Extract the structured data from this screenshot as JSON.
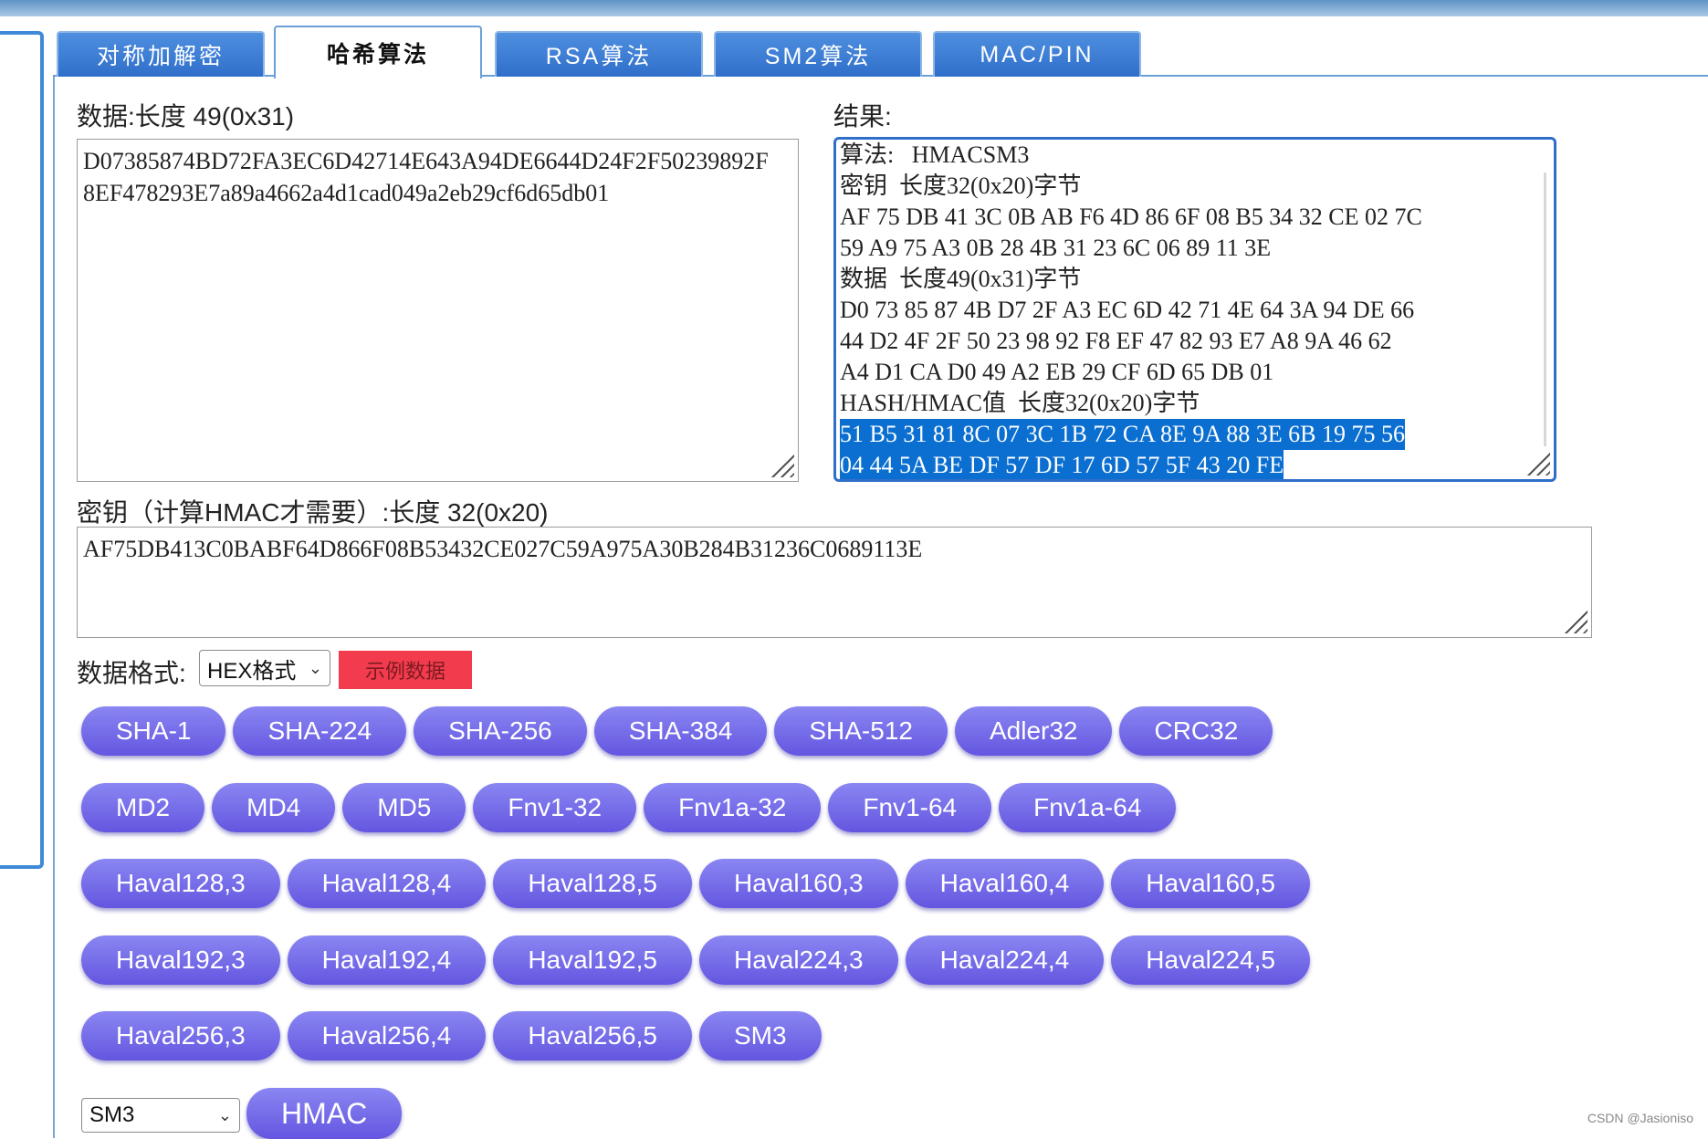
{
  "tabs": [
    "对称加解密",
    "哈希算法",
    "RSA算法",
    "SM2算法",
    "MAC/PIN"
  ],
  "active_tab": "哈希算法",
  "data_section": {
    "label": "数据:长度 49(0x31)",
    "lines": [
      "D07385874BD72FA3EC6D42714E643A94DE6644D24F2F50239892F",
      "8EF478293E7a89a4662a4d1cad049a2eb29cf6d65db01"
    ]
  },
  "result_section": {
    "label": "结果:",
    "lines": [
      "算法:   HMACSM3",
      "密钥  长度32(0x20)字节",
      "AF 75 DB 41 3C 0B AB F6 4D 86 6F 08 B5 34 32 CE 02 7C",
      "59 A9 75 A3 0B 28 4B 31 23 6C 06 89 11 3E",
      "数据  长度49(0x31)字节",
      "D0 73 85 87 4B D7 2F A3 EC 6D 42 71 4E 64 3A 94 DE 66",
      "44 D2 4F 2F 50 23 98 92 F8 EF 47 82 93 E7 A8 9A 46 62",
      "A4 D1 CA D0 49 A2 EB 29 CF 6D 65 DB 01",
      "HASH/HMAC值  长度32(0x20)字节"
    ],
    "selected_lines": [
      "51 B5 31 81 8C 07 3C 1B 72 CA 8E 9A 88 3E 6B 19 75 56",
      "04 44 5A BE DF 57 DF 17 6D 57 5F 43 20 FE"
    ]
  },
  "key_section": {
    "label": "密钥（计算HMAC才需要）:长度 32(0x20)",
    "value": "AF75DB413C0BABF64D866F08B53432CE027C59A975A30B284B31236C0689113E"
  },
  "format": {
    "label": "数据格式:",
    "selected": "HEX格式"
  },
  "example_button": "示例数据",
  "hash_rows": [
    [
      "SHA-1",
      "SHA-224",
      "SHA-256",
      "SHA-384",
      "SHA-512",
      "Adler32",
      "CRC32"
    ],
    [
      "MD2",
      "MD4",
      "MD5",
      "Fnv1-32",
      "Fnv1a-32",
      "Fnv1-64",
      "Fnv1a-64"
    ],
    [
      "Haval128,3",
      "Haval128,4",
      "Haval128,5",
      "Haval160,3",
      "Haval160,4",
      "Haval160,5"
    ],
    [
      "Haval192,3",
      "Haval192,4",
      "Haval192,5",
      "Haval224,3",
      "Haval224,4",
      "Haval224,5"
    ],
    [
      "Haval256,3",
      "Haval256,4",
      "Haval256,5",
      "SM3"
    ]
  ],
  "hmac": {
    "selected": "SM3",
    "button": "HMAC"
  },
  "watermark": "CSDN @Jasioniso"
}
